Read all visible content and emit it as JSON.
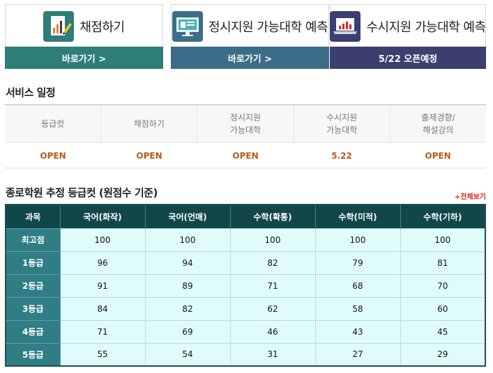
{
  "cards": [
    {
      "title": "채점하기",
      "link": "바로가기 >",
      "icon": "grading-icon"
    },
    {
      "title": "정시지원 가능대학 예측",
      "link": "바로가기 >",
      "icon": "monitor-icon"
    },
    {
      "title": "수시지원 가능대학 예측",
      "link": "5/22 오픈예정",
      "icon": "laptop-chart-icon"
    }
  ],
  "schedule": {
    "title": "서비스 일정",
    "headers": [
      "등급컷",
      "채점하기",
      "정시지원\n가능대학",
      "수시지원\n가능대학",
      "출제경향/\n해설강의"
    ],
    "values": [
      "OPEN",
      "OPEN",
      "OPEN",
      "5.22",
      "OPEN"
    ]
  },
  "grade_table": {
    "title": "종로학원 추정 등급컷 (원점수 기준)",
    "more_link": "+전체보기",
    "columns": [
      "과목",
      "국어(화작)",
      "국어(언매)",
      "수학(확통)",
      "수학(미적)",
      "수학(기하)"
    ],
    "rows": [
      {
        "label": "최고점",
        "values": [
          "100",
          "100",
          "100",
          "100",
          "100"
        ]
      },
      {
        "label": "1등급",
        "values": [
          "96",
          "94",
          "82",
          "79",
          "81"
        ]
      },
      {
        "label": "2등급",
        "values": [
          "91",
          "89",
          "71",
          "68",
          "70"
        ]
      },
      {
        "label": "3등급",
        "values": [
          "84",
          "82",
          "62",
          "58",
          "60"
        ]
      },
      {
        "label": "4등급",
        "values": [
          "71",
          "69",
          "46",
          "43",
          "45"
        ]
      },
      {
        "label": "5등급",
        "values": [
          "55",
          "54",
          "31",
          "27",
          "29"
        ]
      }
    ]
  },
  "colors": {
    "card1": "#2f7d78",
    "card2": "#3c6d88",
    "card3": "#3b3f6f",
    "open_text": "#c0571e",
    "table_header": "#12474a",
    "table_rowhead": "#2f7d85",
    "table_cell": "#dffcfb",
    "more_link": "#d9261c"
  }
}
